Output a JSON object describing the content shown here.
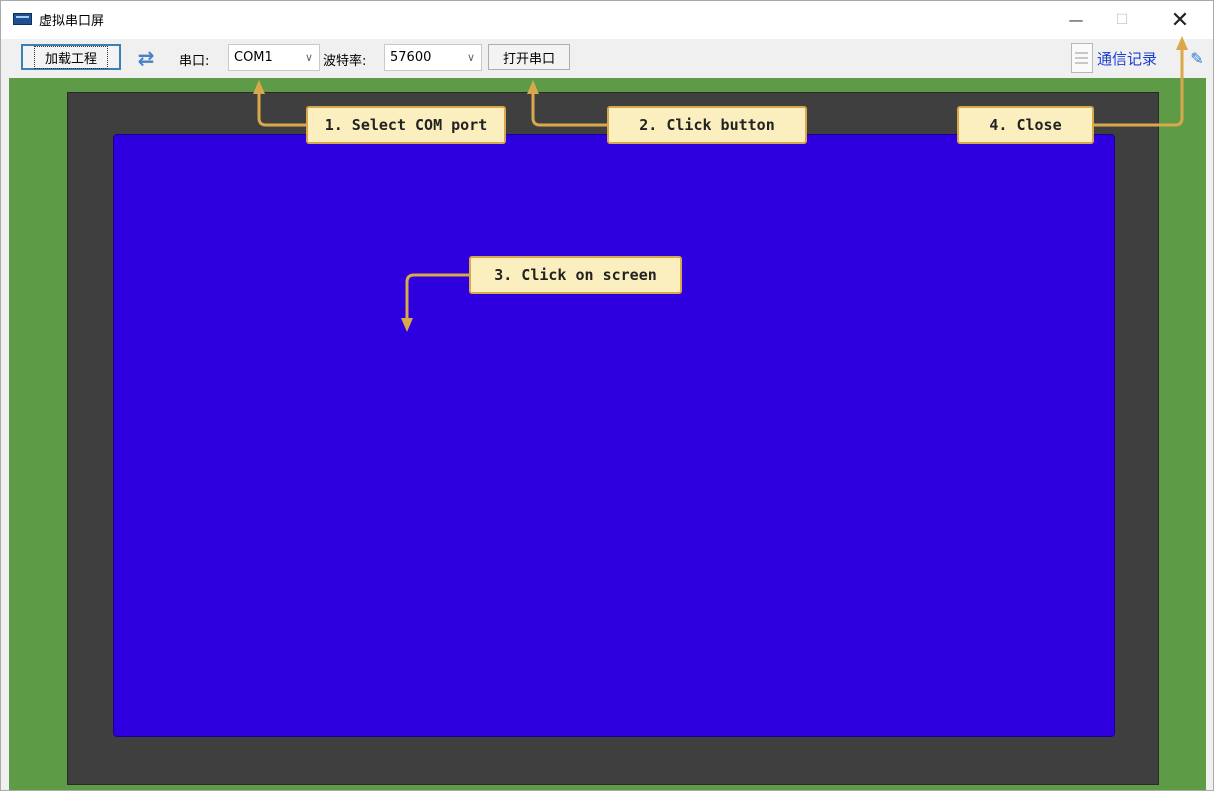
{
  "window": {
    "title": "虚拟串口屏"
  },
  "toolbar": {
    "load_label": "加载工程",
    "port_label": "串口:",
    "port_value": "COM1",
    "baud_label": "波特率:",
    "baud_value": "57600",
    "open_label": "打开串口",
    "log_label": "通信记录"
  },
  "callouts": {
    "step1": "1. Select COM port",
    "step2": "2. Click button",
    "step3": "3. Click on screen",
    "step4": "4. Close"
  },
  "colors": {
    "screen": "#2e00df",
    "bezel": "#3f3f3f",
    "background": "#5d9b47",
    "callout_fill": "#fcefbf",
    "callout_border": "#d8a84a"
  },
  "icons": [
    "app-icon",
    "refresh-icon",
    "document-icon",
    "pin-icon",
    "minimize-icon",
    "maximize-icon",
    "close-icon"
  ]
}
